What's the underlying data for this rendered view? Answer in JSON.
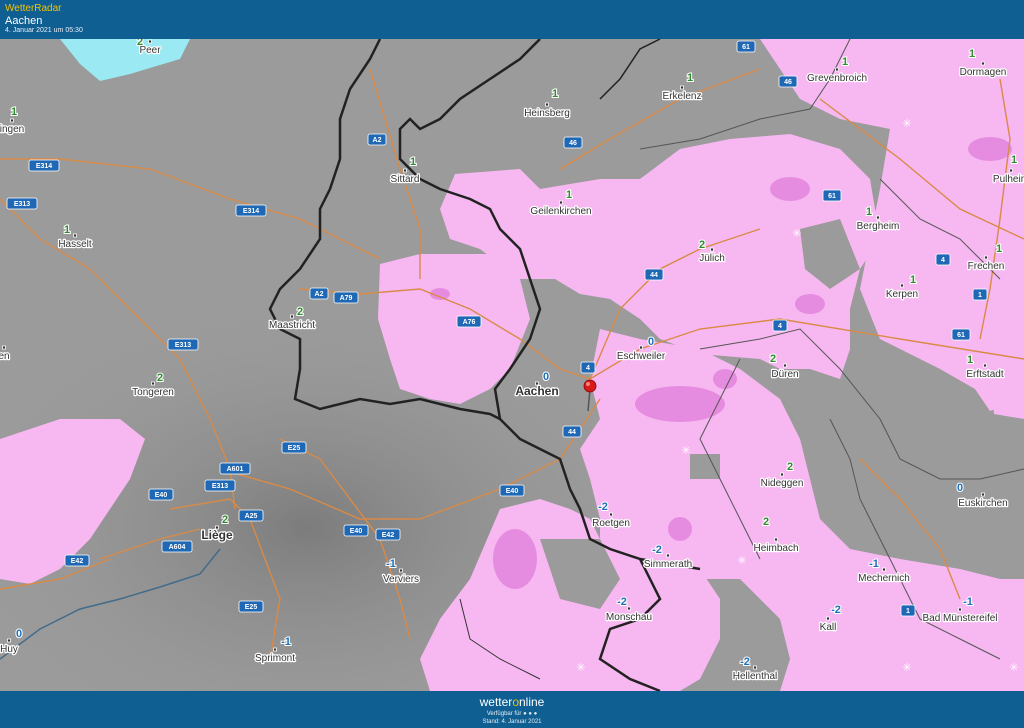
{
  "header": {
    "app_title": "WetterRadar",
    "location": "Aachen",
    "datetime": "4. Januar 2021 um 05:30"
  },
  "footer": {
    "brand_pre": "wetter",
    "brand_o": "o",
    "brand_post": "nline",
    "availability": "Verfügbar für ● ● ●",
    "stand": "Stand: 4. Januar 2021"
  },
  "colors": {
    "header_bg": "#0f5f93",
    "snow": "#f7b8f2",
    "snow_heavy": "#e68ce0",
    "ground": "#9a9a9a",
    "road": "#d98a47",
    "border": "#222222",
    "temp_positive": "#2e8b2e",
    "temp_zero_negative": "#1d6fb8",
    "road_shield": "#1f68b5",
    "marker": "#d71a1a"
  },
  "map": {
    "cities": [
      {
        "name": "Peer"
      },
      {
        "name": "Heinsberg"
      },
      {
        "name": "Erkelenz"
      },
      {
        "name": "Grevenbroich"
      },
      {
        "name": "Dormagen"
      },
      {
        "name": "ingen"
      },
      {
        "name": "Sittard"
      },
      {
        "name": "Geilenkirchen"
      },
      {
        "name": "Pulheim"
      },
      {
        "name": "Hasselt"
      },
      {
        "name": "Jülich"
      },
      {
        "name": "Bergheim"
      },
      {
        "name": "Frechen"
      },
      {
        "name": "Kerpen"
      },
      {
        "name": "Maastricht"
      },
      {
        "name": "Eschweiler"
      },
      {
        "name": "Erftstadt"
      },
      {
        "name": "en"
      },
      {
        "name": "Düren"
      },
      {
        "name": "Tongeren"
      },
      {
        "name": "Aachen"
      },
      {
        "name": "Nideggen"
      },
      {
        "name": "Euskirchen"
      },
      {
        "name": "Roetgen"
      },
      {
        "name": "Liège"
      },
      {
        "name": "Heimbach"
      },
      {
        "name": "Simmerath"
      },
      {
        "name": "Mechernich"
      },
      {
        "name": "Verviers"
      },
      {
        "name": "Monschau"
      },
      {
        "name": "Kall"
      },
      {
        "name": "Bad Münstereifel"
      },
      {
        "name": "Huy"
      },
      {
        "name": "Sprimont"
      },
      {
        "name": "Hellenthal"
      }
    ],
    "temperatures": [
      {
        "city": "Peer",
        "value": "2"
      },
      {
        "city": "Heinsberg",
        "value": "1"
      },
      {
        "city": "Erkelenz",
        "value": "1"
      },
      {
        "city": "Grevenbroich",
        "value": "1"
      },
      {
        "city": "Dormagen",
        "value": "1"
      },
      {
        "city": "ingen",
        "value": "1"
      },
      {
        "city": "Sittard",
        "value": "1"
      },
      {
        "city": "Geilenkirchen",
        "value": "1"
      },
      {
        "city": "Pulheim",
        "value": "1"
      },
      {
        "city": "Hasselt",
        "value": "1"
      },
      {
        "city": "Jülich",
        "value": "2"
      },
      {
        "city": "Bergheim",
        "value": "1"
      },
      {
        "city": "Frechen",
        "value": "1"
      },
      {
        "city": "Kerpen",
        "value": "1"
      },
      {
        "city": "Maastricht",
        "value": "2"
      },
      {
        "city": "Eschweiler",
        "value": "0"
      },
      {
        "city": "Erftstadt",
        "value": "1"
      },
      {
        "city": "Düren",
        "value": "2"
      },
      {
        "city": "Tongeren",
        "value": "2"
      },
      {
        "city": "Aachen",
        "value": "0"
      },
      {
        "city": "Nideggen",
        "value": "2"
      },
      {
        "city": "Euskirchen",
        "value": "0"
      },
      {
        "city": "Roetgen",
        "value": "-2"
      },
      {
        "city": "Liège",
        "value": "2"
      },
      {
        "city": "Heimbach",
        "value": "2"
      },
      {
        "city": "Simmerath",
        "value": "-2"
      },
      {
        "city": "Mechernich",
        "value": "-1"
      },
      {
        "city": "Verviers",
        "value": "-1"
      },
      {
        "city": "Monschau",
        "value": "-2"
      },
      {
        "city": "Kall",
        "value": "-2"
      },
      {
        "city": "Bad Münstereifel",
        "value": "-1"
      },
      {
        "city": "Huy",
        "value": "0"
      },
      {
        "city": "Sprimont",
        "value": "-1"
      },
      {
        "city": "Hellenthal",
        "value": "-2"
      }
    ],
    "road_shields": [
      "61",
      "46",
      "46",
      "A2",
      "E314",
      "E313",
      "E314",
      "61",
      "44",
      "A2",
      "A79",
      "A76",
      "4",
      "4",
      "E313",
      "4",
      "61",
      "44",
      "E25",
      "1",
      "A601",
      "E40",
      "E313",
      "E40",
      "A25",
      "E40",
      "E42",
      "A604",
      "E42",
      "E25",
      "1"
    ],
    "marker_icon": "location-pin-icon",
    "snow_symbol": "snowflake-icon"
  }
}
